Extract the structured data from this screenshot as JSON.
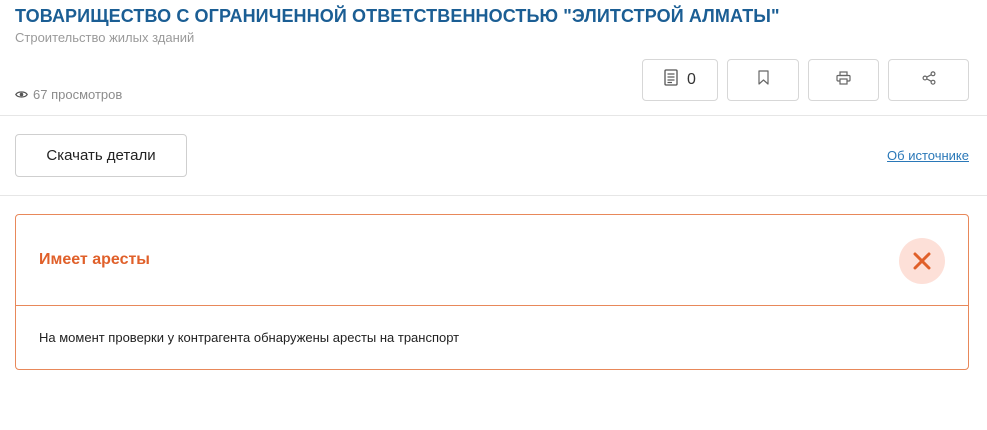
{
  "company": {
    "title": "ТОВАРИЩЕСТВО С ОГРАНИЧЕННОЙ ОТВЕТСТВЕННОСТЬЮ \"ЭЛИТСТРОЙ АЛМАТЫ\"",
    "activity": "Строительство жилых зданий",
    "views": "67 просмотров"
  },
  "toolbar": {
    "notes_count": "0",
    "icons": [
      "notes-icon",
      "bookmark-icon",
      "print-icon",
      "share-icon"
    ]
  },
  "actions": {
    "download_label": "Скачать детали",
    "source_link": "Об источнике"
  },
  "alert": {
    "title": "Имеет аресты",
    "text": "На момент проверки у контрагента обнаружены аресты на транспорт",
    "color": "#e0602a",
    "icon": "close-icon"
  },
  "colors": {
    "title": "#1b5e94",
    "link": "#2a78b8",
    "alert_border": "#e8885a",
    "alert_icon_bg": "#fde0d8"
  }
}
